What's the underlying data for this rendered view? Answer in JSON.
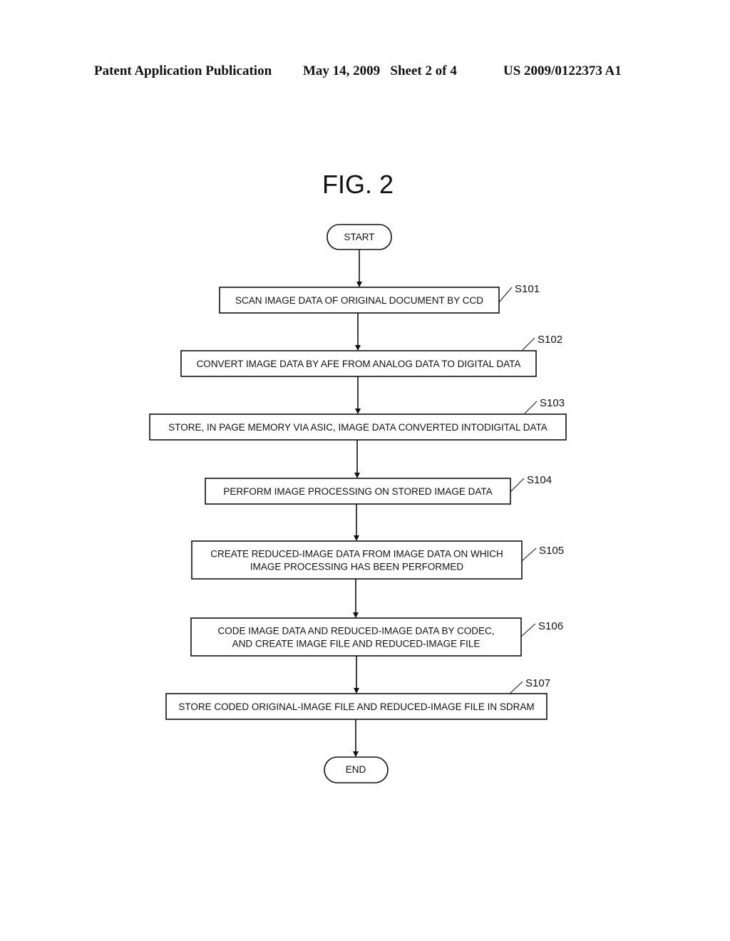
{
  "header": {
    "publication": "Patent Application Publication",
    "date_sheet": "May 14, 2009   Sheet 2 of 4",
    "number": "US 2009/0122373 A1"
  },
  "figure": {
    "title": "FIG. 2",
    "start": "START",
    "end": "END",
    "steps": [
      {
        "id": "S101",
        "lines": [
          "SCAN IMAGE DATA OF ORIGINAL DOCUMENT BY CCD"
        ]
      },
      {
        "id": "S102",
        "lines": [
          "CONVERT IMAGE DATA BY AFE FROM ANALOG DATA TO DIGITAL DATA"
        ]
      },
      {
        "id": "S103",
        "lines": [
          "STORE, IN PAGE MEMORY VIA ASIC, IMAGE DATA CONVERTED INTODIGITAL DATA"
        ]
      },
      {
        "id": "S104",
        "lines": [
          "PERFORM IMAGE PROCESSING ON STORED IMAGE DATA"
        ]
      },
      {
        "id": "S105",
        "lines": [
          "CREATE REDUCED-IMAGE DATA FROM IMAGE DATA ON WHICH",
          "IMAGE PROCESSING HAS BEEN PERFORMED"
        ]
      },
      {
        "id": "S106",
        "lines": [
          "CODE IMAGE DATA AND REDUCED-IMAGE DATA BY CODEC,",
          "AND CREATE IMAGE FILE AND REDUCED-IMAGE FILE"
        ]
      },
      {
        "id": "S107",
        "lines": [
          "STORE CODED ORIGINAL-IMAGE FILE AND REDUCED-IMAGE FILE IN SDRAM"
        ]
      }
    ]
  }
}
